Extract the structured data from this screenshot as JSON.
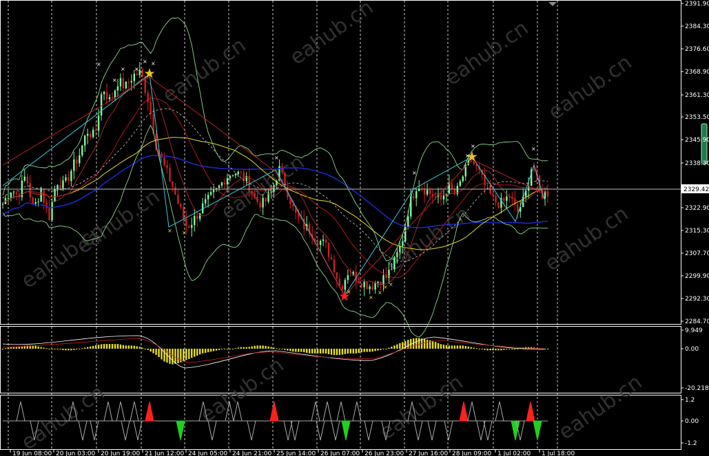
{
  "main_panel": {
    "price_axis_labels": [
      "2391.90",
      "2384.30",
      "2376.60",
      "2368.90",
      "2361.30",
      "2353.50",
      "2345.90",
      "2338.30",
      "2322.90",
      "2315.30",
      "2307.70",
      "2299.90",
      "2292.30",
      "2284.70"
    ],
    "current_price": "2329.42",
    "watermark": "eahub.cn"
  },
  "macd_panel": {
    "axis_labels": [
      "9.949",
      "0.00",
      "-20.218"
    ]
  },
  "osc_panel": {
    "axis_labels": [
      "1.2",
      "0.00",
      "-1.2"
    ]
  },
  "time_axis_labels": [
    "19 Jun 08:00",
    "20 Jun 03:00",
    "20 Jun 19:00",
    "21 Jun 12:00",
    "24 Jun 05:00",
    "24 Jun 21:00",
    "25 Jun 14:00",
    "26 Jun 07:00",
    "26 Jun 23:00",
    "27 Jun 16:00",
    "28 Jun 09:00",
    "1 Jul 02:00",
    "1 Jul 18:00"
  ],
  "colors": {
    "background": "#000000",
    "bull_candle": "#7CFC9A",
    "bear_candle": "#d02020",
    "grid": "#ffffff",
    "ma_yellow": "#e8e020",
    "ma_blue": "#1a2cd0",
    "band_green": "#8fd88f",
    "macd_hist": "#e8e020",
    "star": "#f0c020"
  },
  "chart_data": {
    "type": "candlestick",
    "ylim": [
      2284.7,
      2391.9
    ],
    "price_path": [
      2325,
      2330,
      2328,
      2335,
      2323,
      2330,
      2320,
      2333,
      2331,
      2337,
      2342,
      2350,
      2348,
      2365,
      2360,
      2367,
      2365,
      2369,
      2370,
      2360,
      2345,
      2338,
      2332,
      2324,
      2317,
      2320,
      2324,
      2327,
      2330,
      2334,
      2336,
      2335,
      2332,
      2326,
      2325,
      2329,
      2337,
      2330,
      2322,
      2318,
      2316,
      2313,
      2311,
      2305,
      2296,
      2302,
      2300,
      2298,
      2297,
      2299,
      2300,
      2305,
      2312,
      2325,
      2332,
      2330,
      2328,
      2326,
      2331,
      2328,
      2335,
      2340,
      2336,
      2330,
      2326,
      2325,
      2328,
      2322,
      2327,
      2339,
      2328,
      2329
    ],
    "current_price": 2329.42
  }
}
